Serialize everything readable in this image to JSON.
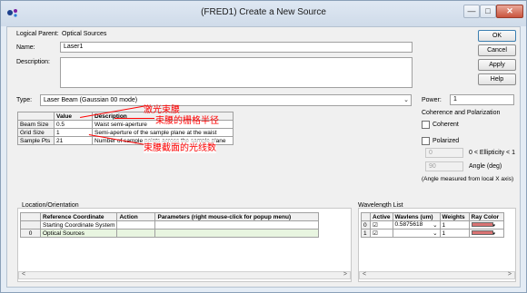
{
  "window": {
    "title": "(FRED1) Create a New Source",
    "min_glyph": "—",
    "max_glyph": "□",
    "close_glyph": "✕"
  },
  "form": {
    "logical_parent_label": "Logical Parent:",
    "logical_parent_value": "Optical Sources",
    "name_label": "Name:",
    "name_value": "Laser1",
    "description_label": "Description:",
    "description_value": "",
    "type_label": "Type:",
    "type_value": "Laser Beam (Gaussian 00 mode)"
  },
  "buttons": {
    "ok": "OK",
    "cancel": "Cancel",
    "apply": "Apply",
    "help": "Help"
  },
  "power": {
    "label": "Power:",
    "value": "1"
  },
  "coherence": {
    "title": "Coherence and Polarization",
    "coherent_label": "Coherent",
    "coherent_checked": false,
    "polarized_label": "Polarized",
    "polarized_checked": false,
    "ellipticity_value": "0",
    "ellipticity_label": "0 < Ellipticity < 1",
    "angle_value": "90",
    "angle_label": "Angle (deg)",
    "note": "(Angle measured from local X axis)"
  },
  "params_table": {
    "headers": [
      "",
      "Value",
      "Description"
    ],
    "rows": [
      {
        "name": "Beam Size",
        "value": "0.5",
        "description": "Waist semi-aperture"
      },
      {
        "name": "Grid Size",
        "value": "1",
        "description": "Semi-aperture of the sample plane at the waist"
      },
      {
        "name": "Sample Pts",
        "value": "21",
        "description": "Number of sample points across the sample plane"
      }
    ]
  },
  "annotations": {
    "laser_beam": "激光束腰",
    "grid_half": "束腰的栅格半径",
    "ray_count": "束腰截面的光线数"
  },
  "location": {
    "title": "Location/Orientation",
    "headers": [
      "",
      "Reference Coordinate",
      "Action",
      "Parameters (right mouse-click for popup menu)"
    ],
    "rows": [
      {
        "index": "",
        "ref": "Starting Coordinate System",
        "action": "",
        "params": ""
      },
      {
        "index": "0",
        "ref": "Optical Sources",
        "action": "",
        "params": ""
      }
    ]
  },
  "wavelength": {
    "title": "Wavelength List",
    "headers": [
      "",
      "Active",
      "Wavlens (um)",
      "Weights",
      "Ray Color"
    ],
    "rows": [
      {
        "index": "0",
        "active": true,
        "wavelength": "0.5875618",
        "weight": "1",
        "color": "#d97373"
      },
      {
        "index": "1",
        "active": true,
        "wavelength": "",
        "weight": "1",
        "color": "#d97373"
      }
    ]
  },
  "scroll": {
    "left_glyph": "<",
    "right_glyph": ">"
  }
}
